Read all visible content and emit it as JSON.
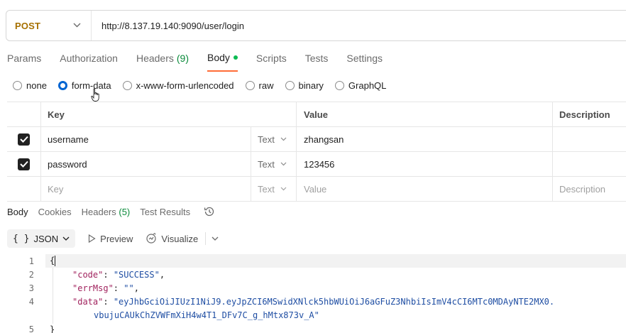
{
  "request": {
    "method": "POST",
    "url": "http://8.137.19.140:9090/user/login"
  },
  "request_tabs": [
    {
      "label": "Params"
    },
    {
      "label": "Authorization"
    },
    {
      "label": "Headers",
      "count": "(9)"
    },
    {
      "label": "Body",
      "active": true,
      "dot": true
    },
    {
      "label": "Scripts"
    },
    {
      "label": "Tests"
    },
    {
      "label": "Settings"
    }
  ],
  "body_types": {
    "none": "none",
    "form_data": "form-data",
    "urlencoded": "x-www-form-urlencoded",
    "raw": "raw",
    "binary": "binary",
    "graphql": "GraphQL",
    "selected": "form-data"
  },
  "kv_table": {
    "headers": {
      "key": "Key",
      "value": "Value",
      "description": "Description"
    },
    "rows": [
      {
        "key": "username",
        "type": "Text",
        "value": "zhangsan",
        "checked": true
      },
      {
        "key": "password",
        "type": "Text",
        "value": "123456",
        "checked": true
      }
    ],
    "placeholder_row": {
      "key": "Key",
      "type": "Text",
      "value": "Value",
      "description": "Description"
    }
  },
  "response_tabs": {
    "body": "Body",
    "cookies": "Cookies",
    "headers": "Headers",
    "headers_count": "(5)",
    "test_results": "Test Results"
  },
  "response_toolbar": {
    "braces": "{ }",
    "format": "JSON",
    "preview": "Preview",
    "visualize": "Visualize"
  },
  "code": {
    "line_numbers": [
      "1",
      "2",
      "3",
      "4",
      "",
      "5"
    ],
    "open_brace": "{",
    "close_brace": "}",
    "code_key": "\"code\"",
    "code_val": "\"SUCCESS\"",
    "errmsg_key": "\"errMsg\"",
    "errmsg_val": "\"\"",
    "data_key": "\"data\"",
    "data_val_1": "\"eyJhbGciOiJIUzI1NiJ9.eyJpZCI6MSwidXNlck5hbWUiOiJ6aGFuZ3NhbiIsImV4cCI6MTc0MDAyNTE2MX0.",
    "data_val_2": "vbujuCAUkChZVWFmXiH4w4T1_DFv7C_g_hMtx873v_A\""
  },
  "colors": {
    "method": "#a67000",
    "active_tab_underline": "#ff6c37",
    "body_dot": "#0cbb52",
    "radio_selected": "#0265d2",
    "json_key": "#a1235e",
    "json_string": "#1f4ea3"
  }
}
